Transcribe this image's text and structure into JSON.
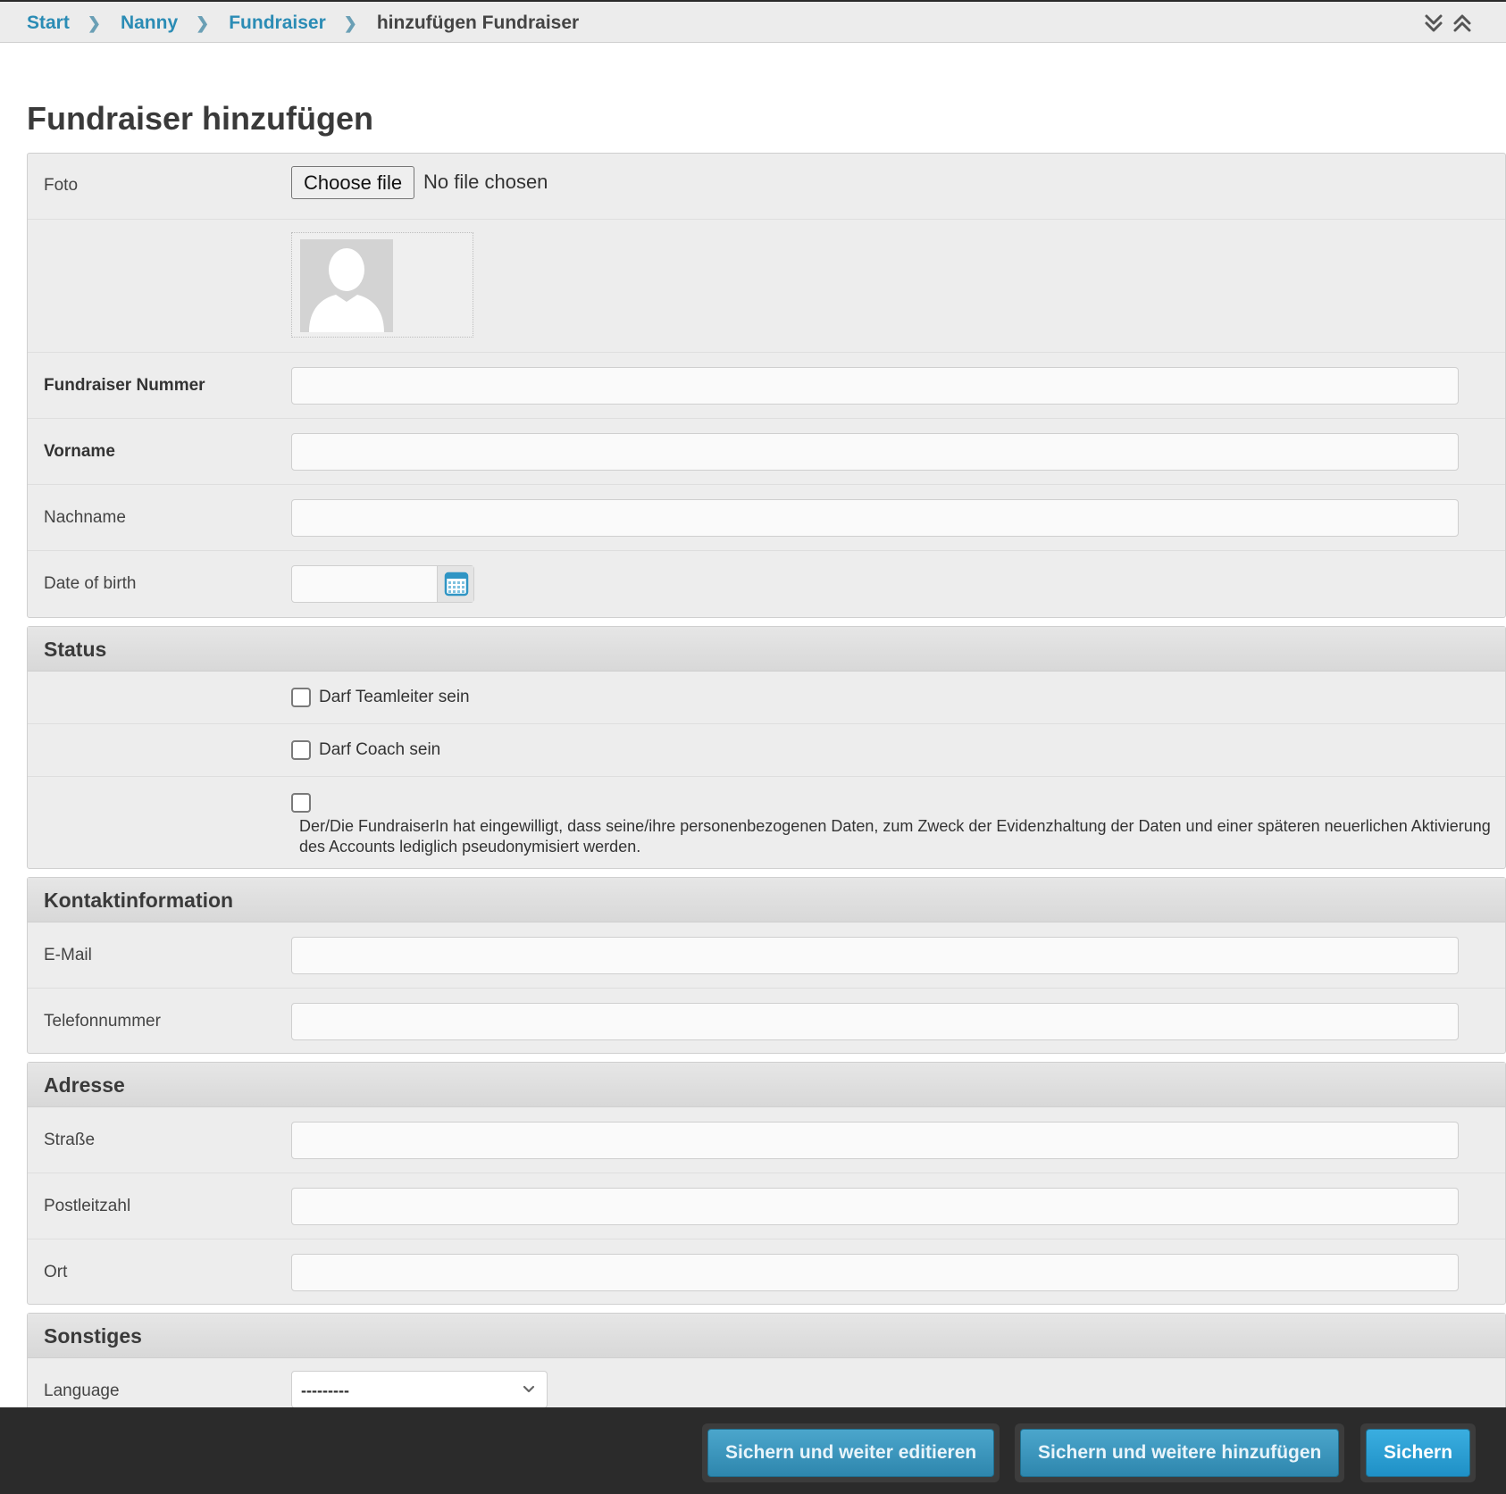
{
  "breadcrumb": {
    "items": [
      "Start",
      "Nanny",
      "Fundraiser"
    ],
    "current": "hinzufügen Fundraiser"
  },
  "page_title": "Fundraiser hinzufügen",
  "main": {
    "foto_label": "Foto",
    "choose_file": "Choose file",
    "no_file": "No file chosen",
    "fundraiser_nummer_label": "Fundraiser Nummer",
    "vorname_label": "Vorname",
    "nachname_label": "Nachname",
    "date_of_birth_label": "Date of birth"
  },
  "status": {
    "heading": "Status",
    "teamleiter_label": "Darf Teamleiter sein",
    "coach_label": "Darf Coach sein",
    "consent_text": "Der/Die FundraiserIn hat eingewilligt, dass seine/ihre personenbezogenen Daten, zum Zweck der Evidenzhaltung der Daten und einer späteren neuerlichen Aktivierung des Accounts lediglich pseudonymisiert werden."
  },
  "kontakt": {
    "heading": "Kontaktinformation",
    "email_label": "E-Mail",
    "telefon_label": "Telefonnummer"
  },
  "adresse": {
    "heading": "Adresse",
    "strasse_label": "Straße",
    "plz_label": "Postleitzahl",
    "ort_label": "Ort"
  },
  "sonstiges": {
    "heading": "Sonstiges",
    "language_label": "Language",
    "language_value": "---------"
  },
  "footer": {
    "save_continue": "Sichern und weiter editieren",
    "save_add_another": "Sichern und weitere hinzufügen",
    "save": "Sichern"
  },
  "colors": {
    "link": "#2b8cb5",
    "button": "#2e86ad",
    "footer_bg": "#2b2b2b"
  }
}
